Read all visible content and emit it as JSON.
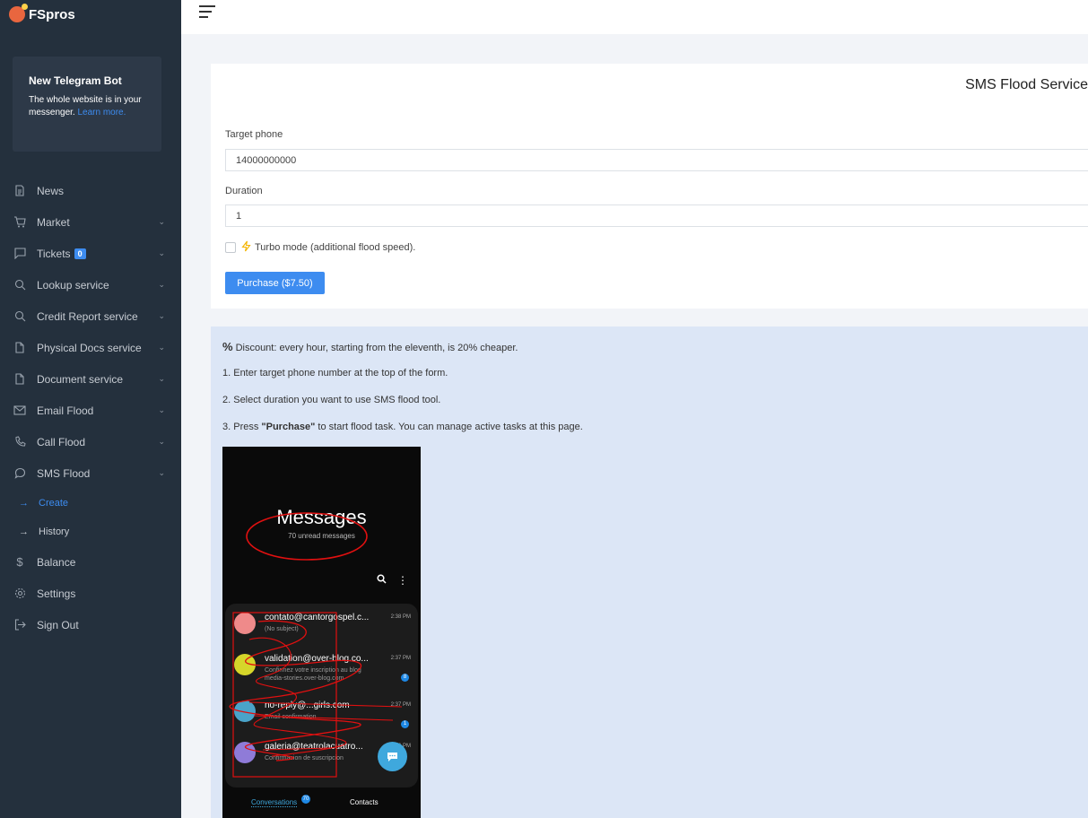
{
  "brand": {
    "name": "FSpros"
  },
  "promo": {
    "title": "New Telegram Bot",
    "text": "The whole website is in your messenger. ",
    "link": "Learn more."
  },
  "nav": {
    "news": "News",
    "market": "Market",
    "tickets": "Tickets",
    "tickets_count": "0",
    "lookup": "Lookup service",
    "credit": "Credit Report service",
    "physical": "Physical Docs service",
    "document": "Document service",
    "email_flood": "Email Flood",
    "call_flood": "Call Flood",
    "sms_flood": "SMS Flood",
    "create": "Create",
    "history": "History",
    "balance": "Balance",
    "settings": "Settings",
    "signout": "Sign Out"
  },
  "form": {
    "title": "SMS Flood Service",
    "target_label": "Target phone",
    "target_value": "14000000000",
    "duration_label": "Duration",
    "duration_value": "1",
    "turbo_label": "Turbo mode (additional flood speed).",
    "purchase_label": "Purchase ($7.50)"
  },
  "info": {
    "discount": "Discount: every hour, starting from the eleventh, is 20% cheaper.",
    "step1": "1. Enter target phone number at the top of the form.",
    "step2": "2. Select duration you want to use SMS flood tool.",
    "step3_prefix": "3. Press ",
    "step3_bold": "\"Purchase\"",
    "step3_suffix": " to start flood task. You can manage active tasks at this page."
  },
  "phone": {
    "title": "Messages",
    "subtitle": "70 unread messages",
    "conversations": [
      {
        "name": "contato@cantorgospel.c...",
        "preview": "(No subject)",
        "time": "2:38 PM",
        "color": "#ef8a8a",
        "unread": ""
      },
      {
        "name": "validation@over-blog.co...",
        "preview": "Confirmez votre inscription au blog media-stories.over-blog.com",
        "time": "2:37 PM",
        "color": "#d6d62a",
        "unread": "8"
      },
      {
        "name": "no-reply@...girls.com",
        "preview": "Email confirmation",
        "time": "2:37 PM",
        "color": "#4aa3c9",
        "unread": "1"
      },
      {
        "name": "galeria@teatrolacuatro...",
        "preview": "Confirmacion de suscripcion",
        "time": "2:36 PM",
        "color": "#8f7bd8",
        "unread": ""
      }
    ],
    "tab_conversations": "Conversations",
    "tab_conversations_badge": "70",
    "tab_contacts": "Contacts"
  },
  "colors": {
    "accent": "#3d8cf0",
    "sidebar": "#24303d",
    "info_bg": "#dce6f6"
  }
}
